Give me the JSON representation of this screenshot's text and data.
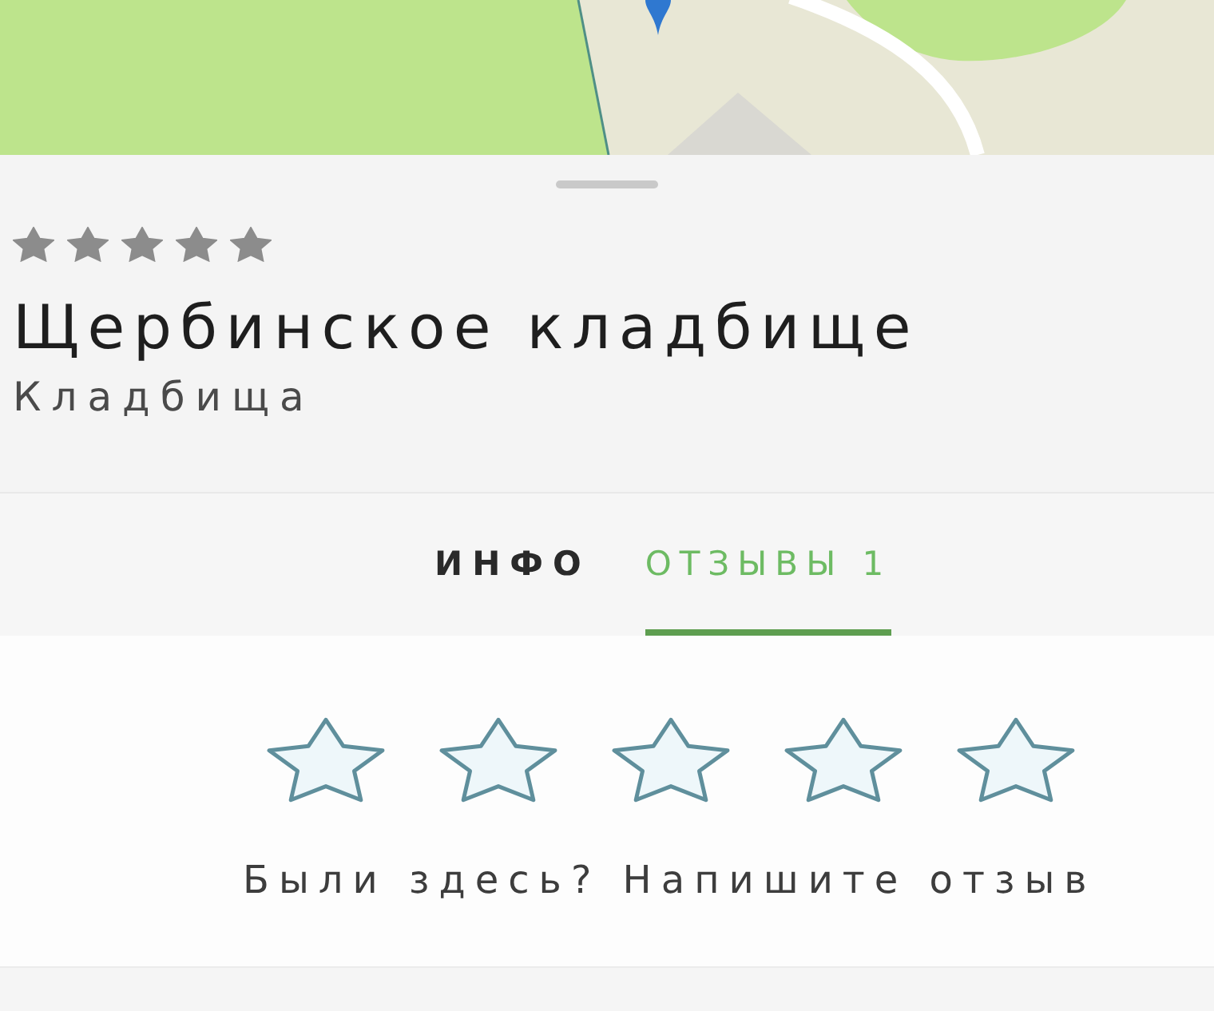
{
  "place": {
    "stars": 5,
    "title": "Щербинское кладбище",
    "category": "Кладбища"
  },
  "tabs": [
    {
      "label": "ИНФО",
      "selected": false
    },
    {
      "label": "ОТЗЫВЫ 1",
      "selected": true
    }
  ],
  "review": {
    "stars": 0,
    "prompt": "Были здесь? Напишите отзыв"
  }
}
